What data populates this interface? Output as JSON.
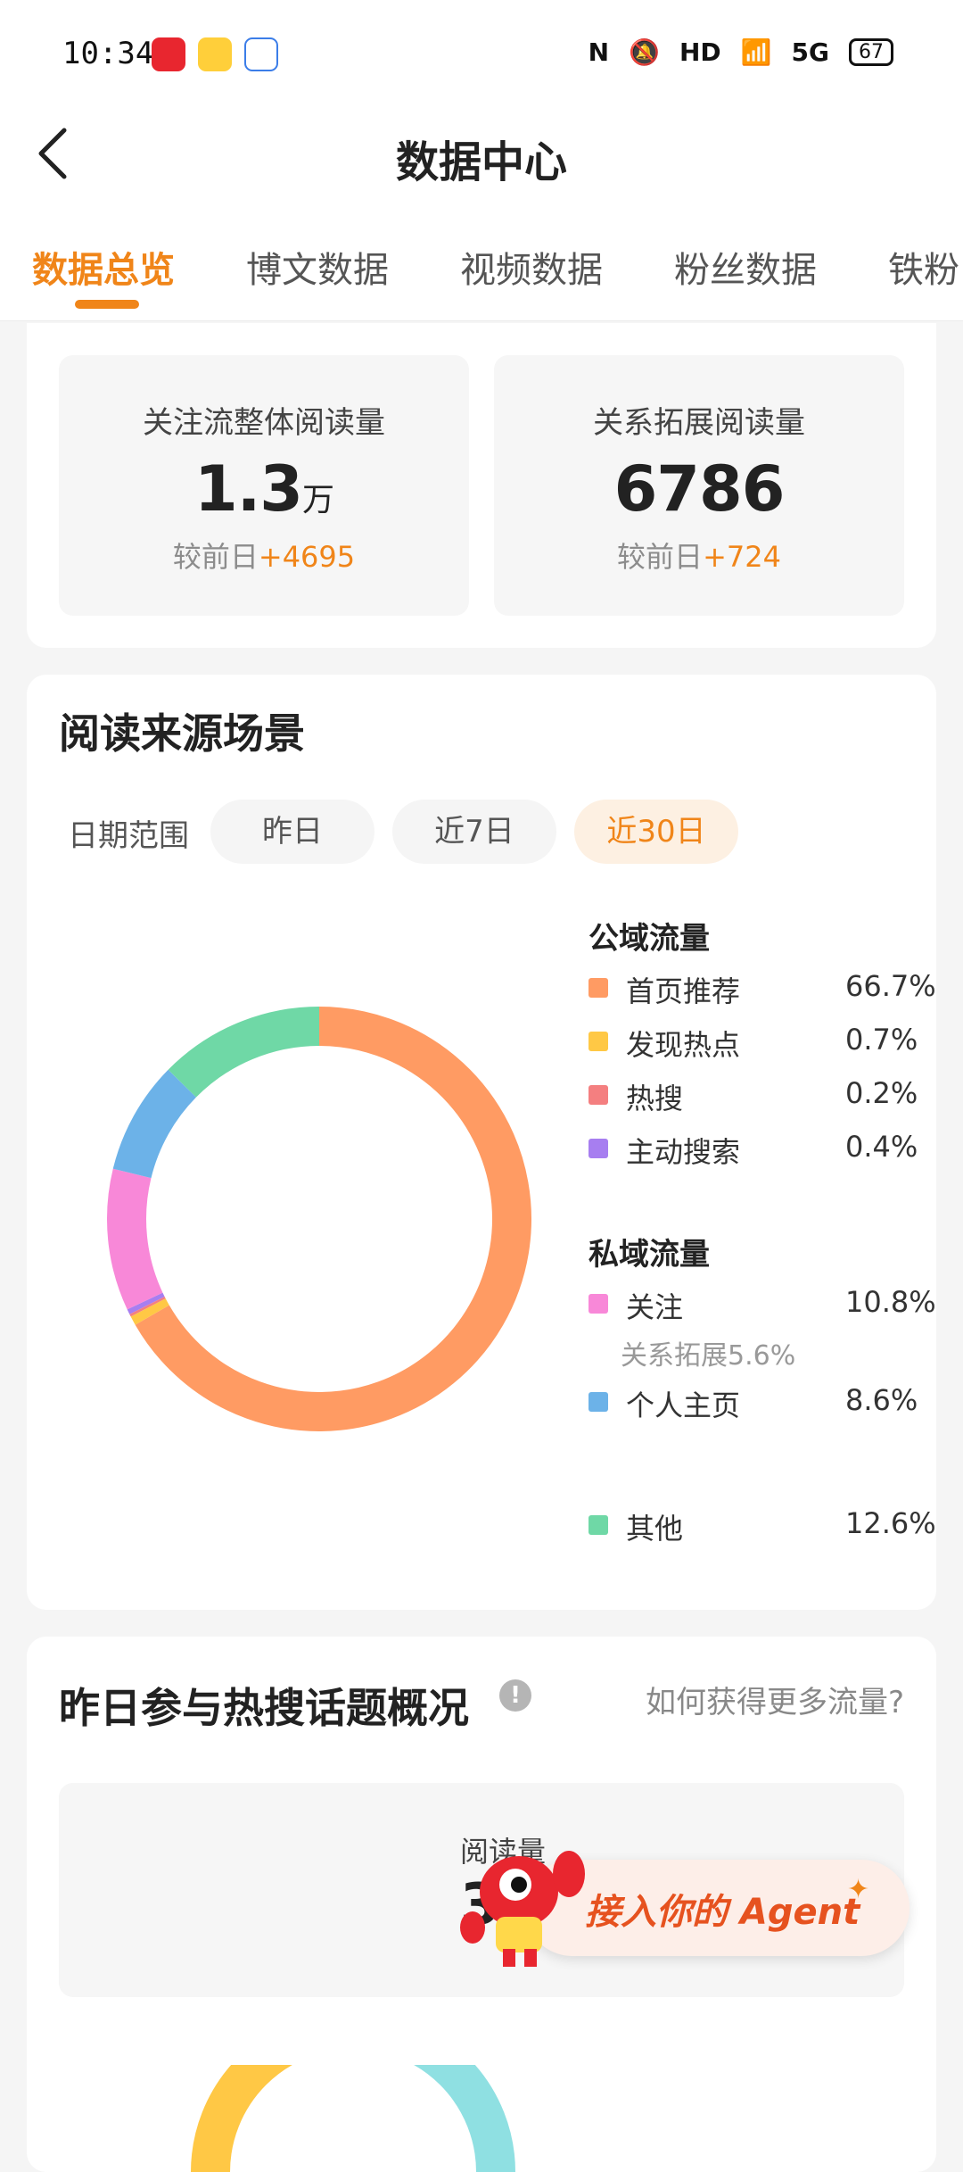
{
  "status_bar": {
    "time": "10:34",
    "hd": "HD",
    "net": "5G",
    "battery": "67"
  },
  "header": {
    "title": "数据中心"
  },
  "tabs": [
    {
      "label": "数据总览",
      "active": true
    },
    {
      "label": "博文数据",
      "active": false
    },
    {
      "label": "视频数据",
      "active": false
    },
    {
      "label": "粉丝数据",
      "active": false
    },
    {
      "label": "铁粉",
      "active": false
    }
  ],
  "overview": {
    "cards": [
      {
        "label": "关注流整体阅读量",
        "value": "1.3",
        "unit": "万",
        "compare_prefix": "较前日",
        "compare_delta": "+4695"
      },
      {
        "label": "关系拓展阅读量",
        "value": "6786",
        "unit": "",
        "compare_prefix": "较前日",
        "compare_delta": "+724"
      }
    ]
  },
  "source": {
    "title": "阅读来源场景",
    "date_label": "日期范围",
    "date_options": [
      {
        "label": "昨日",
        "active": false
      },
      {
        "label": "近7日",
        "active": false
      },
      {
        "label": "近30日",
        "active": true
      }
    ],
    "public_title": "公域流量",
    "private_title": "私域流量",
    "relation_note": "关系拓展5.6%"
  },
  "chart_data": {
    "type": "pie",
    "donut": true,
    "categories": [
      "首页推荐",
      "发现热点",
      "热搜",
      "主动搜索",
      "关注",
      "个人主页",
      "其他"
    ],
    "labels": [
      "66.7%",
      "0.7%",
      "0.2%",
      "0.4%",
      "10.8%",
      "8.6%",
      "12.6%"
    ],
    "values": [
      66.7,
      0.7,
      0.2,
      0.4,
      10.8,
      8.6,
      12.6
    ],
    "colors": [
      "#ff9b63",
      "#ffc845",
      "#f47f80",
      "#a77ef0",
      "#f888d8",
      "#6cb2e8",
      "#6fd8a6"
    ]
  },
  "hot_topics": {
    "title": "昨日参与热搜话题概况",
    "info_icon": "!",
    "more_link": "如何获得更多流量?",
    "read_label": "阅读量",
    "read_value": "3.5"
  },
  "agent_promo": {
    "text": "接入你的 Agent",
    "spark": "✦"
  }
}
